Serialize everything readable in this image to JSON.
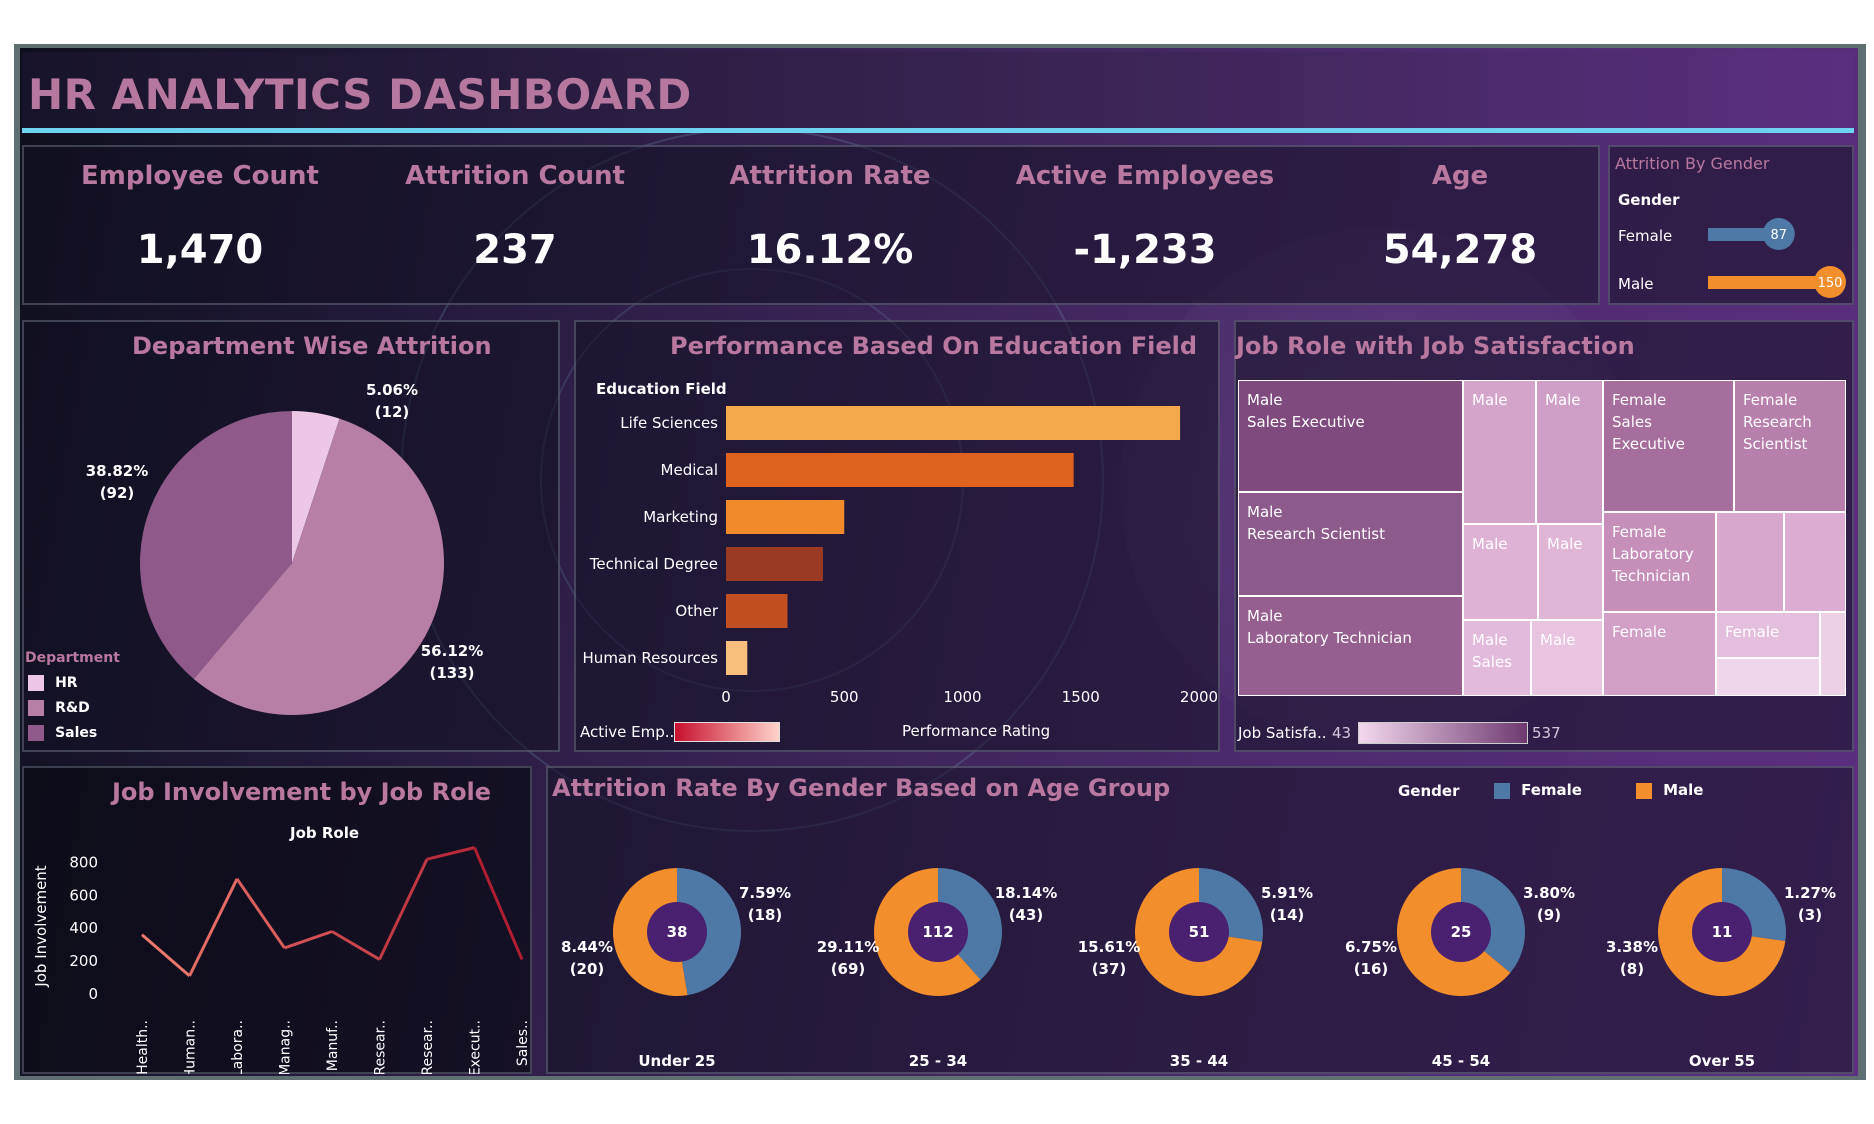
{
  "title": "HR ANALYTICS DASHBOARD",
  "kpis": {
    "employee_count": {
      "label": "Employee Count",
      "value": "1,470"
    },
    "attrition_count": {
      "label": "Attrition Count",
      "value": "237"
    },
    "attrition_rate": {
      "label": "Attrition Rate",
      "value": "16.12%"
    },
    "active_employees": {
      "label": "Active Employees",
      "value": "-1,233"
    },
    "age": {
      "label": "Age",
      "value": "54,278"
    }
  },
  "attrition_by_gender": {
    "title": "Attrition By Gender",
    "header": "Gender",
    "rows": [
      {
        "label": "Female",
        "value": 87,
        "color": "#4e79a7"
      },
      {
        "label": "Male",
        "value": 150,
        "color": "#f28e2b"
      }
    ]
  },
  "department": {
    "title": "Department Wise Attrition",
    "legend_title": "Department",
    "slices": [
      {
        "label": "HR",
        "value": 12,
        "pct": "5.06%",
        "count": "(12)",
        "color": "#ecc8e6"
      },
      {
        "label": "R&D",
        "value": 133,
        "pct": "56.12%",
        "count": "(133)",
        "color": "#b77fa6"
      },
      {
        "label": "Sales",
        "value": 92,
        "pct": "38.82%",
        "count": "(92)",
        "color": "#8f5a8a"
      }
    ]
  },
  "education": {
    "title": "Performance Based On Education Field",
    "axis_title": "Education Field",
    "x_title": "Performance Rating",
    "legend_label": "Active Emp..",
    "ticks": [
      "0",
      "500",
      "1000",
      "1500",
      "2000"
    ]
  },
  "job_satisfaction": {
    "title": "Job Role  with Job Satisfaction",
    "legend_label": "Job Satisfa..",
    "legend_min": "43",
    "legend_max": "537",
    "cells": [
      {
        "text": "Male\nSales Executive"
      },
      {
        "text": "Male\nResearch Scientist"
      },
      {
        "text": "Male\nLaboratory Technician"
      },
      {
        "text": "Male"
      },
      {
        "text": "Male"
      },
      {
        "text": "Male"
      },
      {
        "text": "Male"
      },
      {
        "text": "Male\nSales"
      },
      {
        "text": "Male"
      },
      {
        "text": "Female\nSales Executive"
      },
      {
        "text": "Female\nResearch\nScientist"
      },
      {
        "text": "Female\nLaboratory\nTechnician"
      },
      {
        "text": "Female"
      },
      {
        "text": "Female"
      }
    ]
  },
  "job_involvement": {
    "title": "Job Involvement by Job Role",
    "subtitle": "Job Role",
    "y_title": "Job Involvement"
  },
  "age_group": {
    "title": "Attrition Rate By Gender  Based on Age Group",
    "legend_title": "Gender",
    "legend": [
      {
        "label": "Female",
        "color": "#4e79a7"
      },
      {
        "label": "Male",
        "color": "#f28e2b"
      }
    ],
    "groups": [
      {
        "label": "Under 25",
        "total": "38",
        "female": 18,
        "male": 20,
        "f_pct": "7.59%",
        "f_cnt": "(18)",
        "m_pct": "8.44%",
        "m_cnt": "(20)"
      },
      {
        "label": "25 - 34",
        "total": "112",
        "female": 43,
        "male": 69,
        "f_pct": "18.14%",
        "f_cnt": "(43)",
        "m_pct": "29.11%",
        "m_cnt": "(69)"
      },
      {
        "label": "35 - 44",
        "total": "51",
        "female": 14,
        "male": 37,
        "f_pct": "5.91%",
        "f_cnt": "(14)",
        "m_pct": "15.61%",
        "m_cnt": "(37)"
      },
      {
        "label": "45 - 54",
        "total": "25",
        "female": 9,
        "male": 16,
        "f_pct": "3.80%",
        "f_cnt": "(9)",
        "m_pct": "6.75%",
        "m_cnt": "(16)"
      },
      {
        "label": "Over 55",
        "total": "11",
        "female": 3,
        "male": 8,
        "f_pct": "1.27%",
        "f_cnt": "(3)",
        "m_pct": "3.38%",
        "m_cnt": "(8)"
      }
    ]
  },
  "chart_data": [
    {
      "type": "pie",
      "title": "Department Wise Attrition",
      "categories": [
        "HR",
        "R&D",
        "Sales"
      ],
      "values": [
        12,
        133,
        92
      ]
    },
    {
      "type": "bar",
      "title": "Performance Based On Education Field",
      "categories": [
        "Life Sciences",
        "Medical",
        "Marketing",
        "Technical Degree",
        "Other",
        "Human Resources"
      ],
      "values": [
        1920,
        1470,
        500,
        410,
        260,
        90
      ],
      "colors": [
        "#f4a84c",
        "#e0621f",
        "#f08a2a",
        "#9b3a22",
        "#c24f22",
        "#f7be7e"
      ],
      "xlabel": "Performance Rating",
      "ylabel": "Education Field",
      "xlim": [
        0,
        2000
      ]
    },
    {
      "type": "line",
      "title": "Job Involvement by Job Role",
      "categories": [
        "Health..",
        "Human..",
        "Labora..",
        "Manag..",
        "Manuf..",
        "Resear..",
        "Resear..",
        "Sales Execut..",
        "Sales.."
      ],
      "values": [
        360,
        110,
        700,
        280,
        380,
        210,
        820,
        890,
        210
      ],
      "ylabel": "Job Involvement",
      "ylim": [
        0,
        900
      ],
      "yticks": [
        0,
        200,
        400,
        600,
        800
      ]
    },
    {
      "type": "pie",
      "title": "Attrition Rate By Gender  Based on Age Group",
      "categories": [
        "Under 25",
        "25 - 34",
        "35 - 44",
        "45 - 54",
        "Over 55"
      ],
      "series": [
        {
          "name": "Female",
          "values": [
            18,
            43,
            14,
            9,
            3
          ]
        },
        {
          "name": "Male",
          "values": [
            20,
            69,
            37,
            16,
            8
          ]
        }
      ]
    }
  ]
}
